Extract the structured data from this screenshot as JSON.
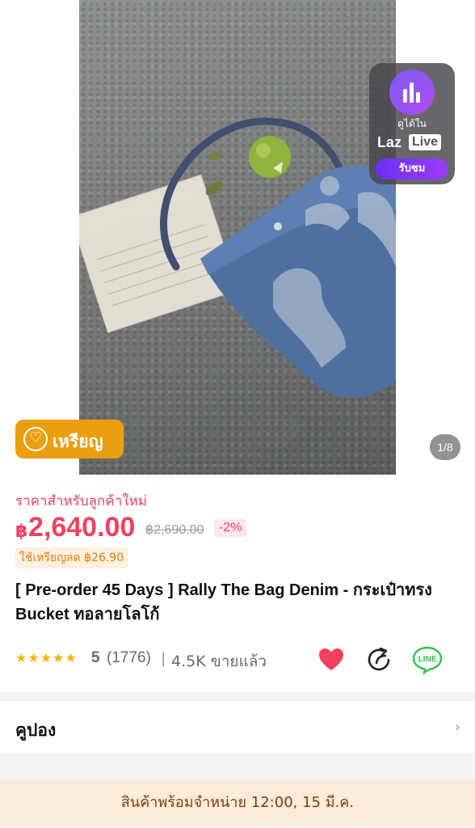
{
  "gallery": {
    "live_badge": {
      "watch_text": "ดูได้ใน",
      "brand_laz": "Laz",
      "brand_live": "Live",
      "button": "รับชม"
    },
    "coin_badge": "เหรียญ",
    "page_indicator": "1/8"
  },
  "product": {
    "new_customer_label": "ราคาสำหรับลูกค้าใหม่",
    "currency": "฿",
    "price": "2,640.00",
    "old_price": "฿2,690.00",
    "discount": "-2%",
    "coin_discount": "ใช้เหรียญลด ฿26.90",
    "title": "[ Pre-order 45 Days ] Rally The Bag Denim - กระเป๋าทรง Bucket ทอลายโลโก้",
    "rating": {
      "stars": "★★★★★",
      "score": "5",
      "count": "(1776)",
      "separator": "|",
      "sold": "4.5K ขายแล้ว"
    }
  },
  "coupon": {
    "label": "คูปอง",
    "chevron": "›"
  },
  "banner": {
    "text": "สินค้าพร้อมจำหน่าย 12:00, 15 มี.ค."
  },
  "colors": {
    "price": "#f3405f",
    "coin_badge": "#eb9f0f",
    "banner_bg": "#fdebd9",
    "line_green": "#2fc54d"
  }
}
